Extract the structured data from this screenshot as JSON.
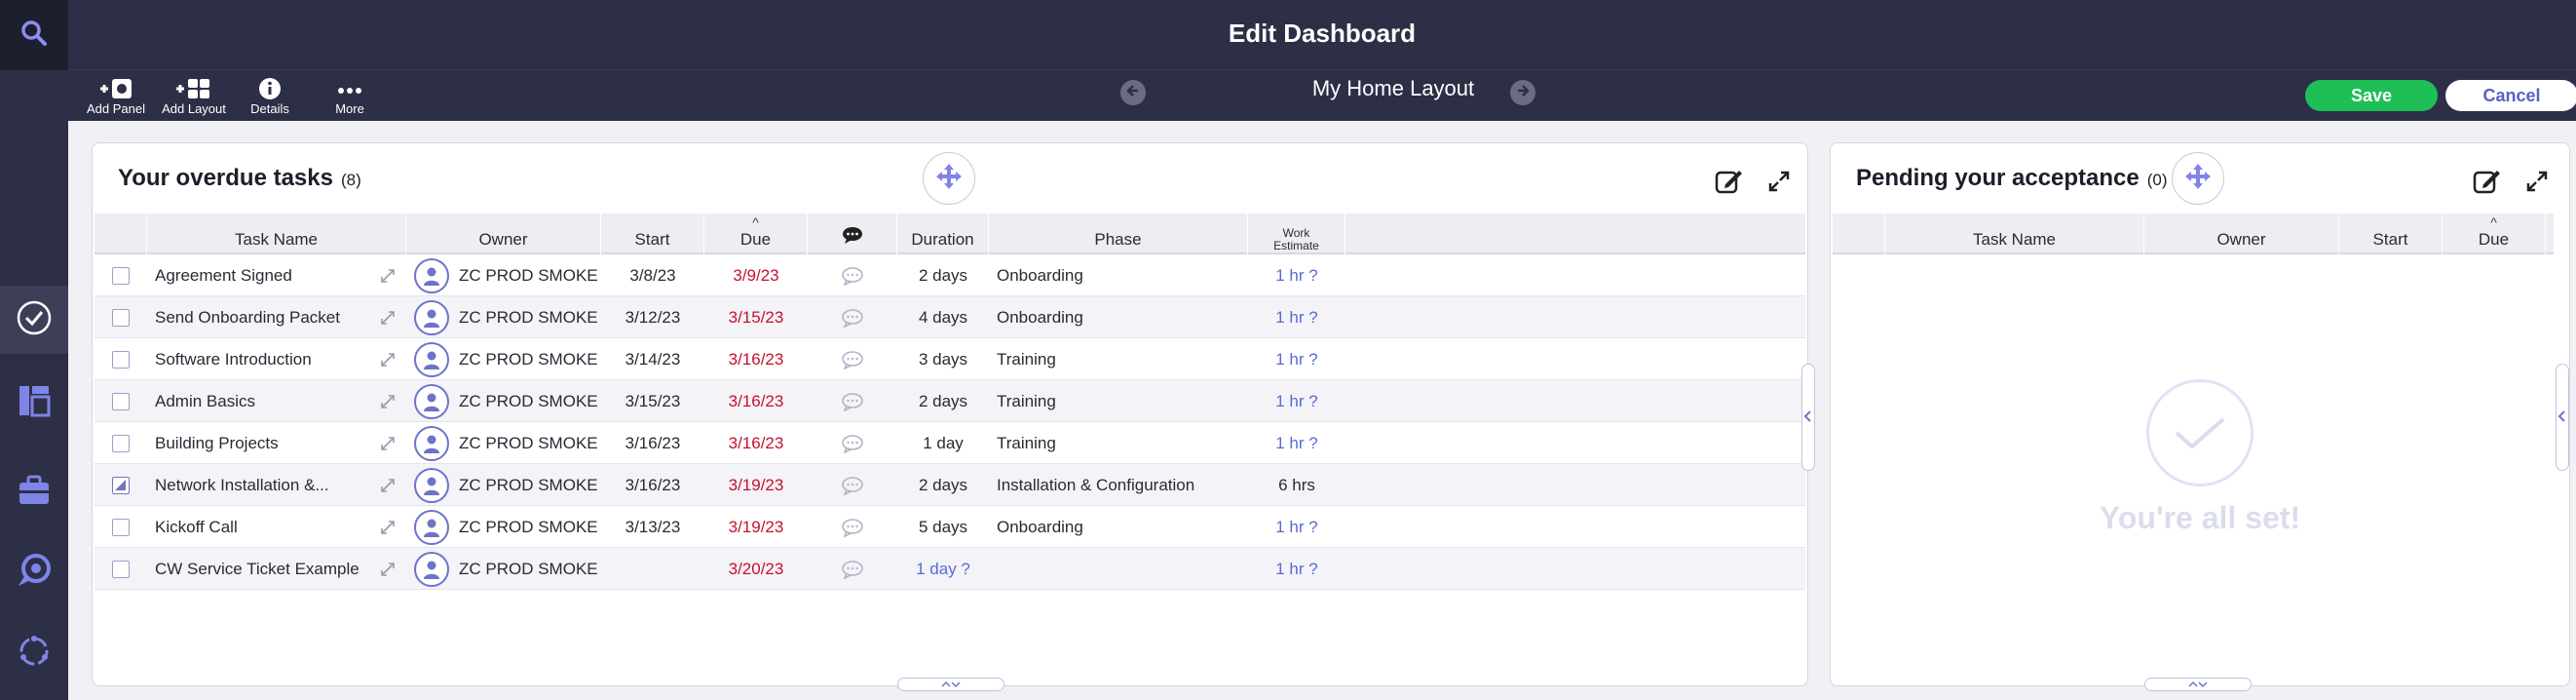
{
  "header": {
    "title": "Edit Dashboard"
  },
  "toolbar": {
    "add_panel": "Add Panel",
    "add_layout": "Add Layout",
    "details": "Details",
    "more": "More",
    "layout_name": "My Home Layout",
    "save": "Save",
    "cancel": "Cancel"
  },
  "panel1": {
    "title": "Your overdue tasks",
    "count": "(8)",
    "columns": {
      "task_name": "Task Name",
      "owner": "Owner",
      "start": "Start",
      "due": "Due",
      "duration": "Duration",
      "phase": "Phase",
      "work_estimate_1": "Work",
      "work_estimate_2": "Estimate"
    },
    "rows": [
      {
        "name": "Agreement Signed",
        "owner": "ZC PROD SMOKE",
        "start": "3/8/23",
        "due": "3/9/23",
        "duration": "2 days",
        "phase": "Onboarding",
        "estimate": "1 hr ?",
        "checked": false
      },
      {
        "name": "Send Onboarding Packet",
        "owner": "ZC PROD SMOKE",
        "start": "3/12/23",
        "due": "3/15/23",
        "duration": "4 days",
        "phase": "Onboarding",
        "estimate": "1 hr ?",
        "checked": false
      },
      {
        "name": "Software Introduction",
        "owner": "ZC PROD SMOKE",
        "start": "3/14/23",
        "due": "3/16/23",
        "duration": "3 days",
        "phase": "Training",
        "estimate": "1 hr ?",
        "checked": false
      },
      {
        "name": "Admin Basics",
        "owner": "ZC PROD SMOKE",
        "start": "3/15/23",
        "due": "3/16/23",
        "duration": "2 days",
        "phase": "Training",
        "estimate": "1 hr ?",
        "checked": false
      },
      {
        "name": "Building Projects",
        "owner": "ZC PROD SMOKE",
        "start": "3/16/23",
        "due": "3/16/23",
        "duration": "1 day",
        "phase": "Training",
        "estimate": "1 hr ?",
        "checked": false
      },
      {
        "name": "Network Installation &...",
        "owner": "ZC PROD SMOKE",
        "start": "3/16/23",
        "due": "3/19/23",
        "duration": "2 days",
        "phase": "Installation & Configuration",
        "estimate": "6 hrs",
        "checked": true
      },
      {
        "name": "Kickoff Call",
        "owner": "ZC PROD SMOKE",
        "start": "3/13/23",
        "due": "3/19/23",
        "duration": "5 days",
        "phase": "Onboarding",
        "estimate": "1 hr ?",
        "checked": false
      },
      {
        "name": "CW Service Ticket Example",
        "owner": "ZC PROD SMOKE",
        "start": "",
        "due": "3/20/23",
        "duration": "1 day ?",
        "phase": "",
        "estimate": "1 hr ?",
        "checked": false
      }
    ]
  },
  "panel2": {
    "title": "Pending your acceptance",
    "count": "(0)",
    "columns": {
      "task_name": "Task Name",
      "owner": "Owner",
      "start": "Start",
      "due": "Due"
    },
    "empty_message": "You're all set!"
  },
  "colors": {
    "accent": "#5b5fc7",
    "save": "#1fbf57",
    "overdue": "#c8102e",
    "header_bg": "#2d2f46"
  }
}
